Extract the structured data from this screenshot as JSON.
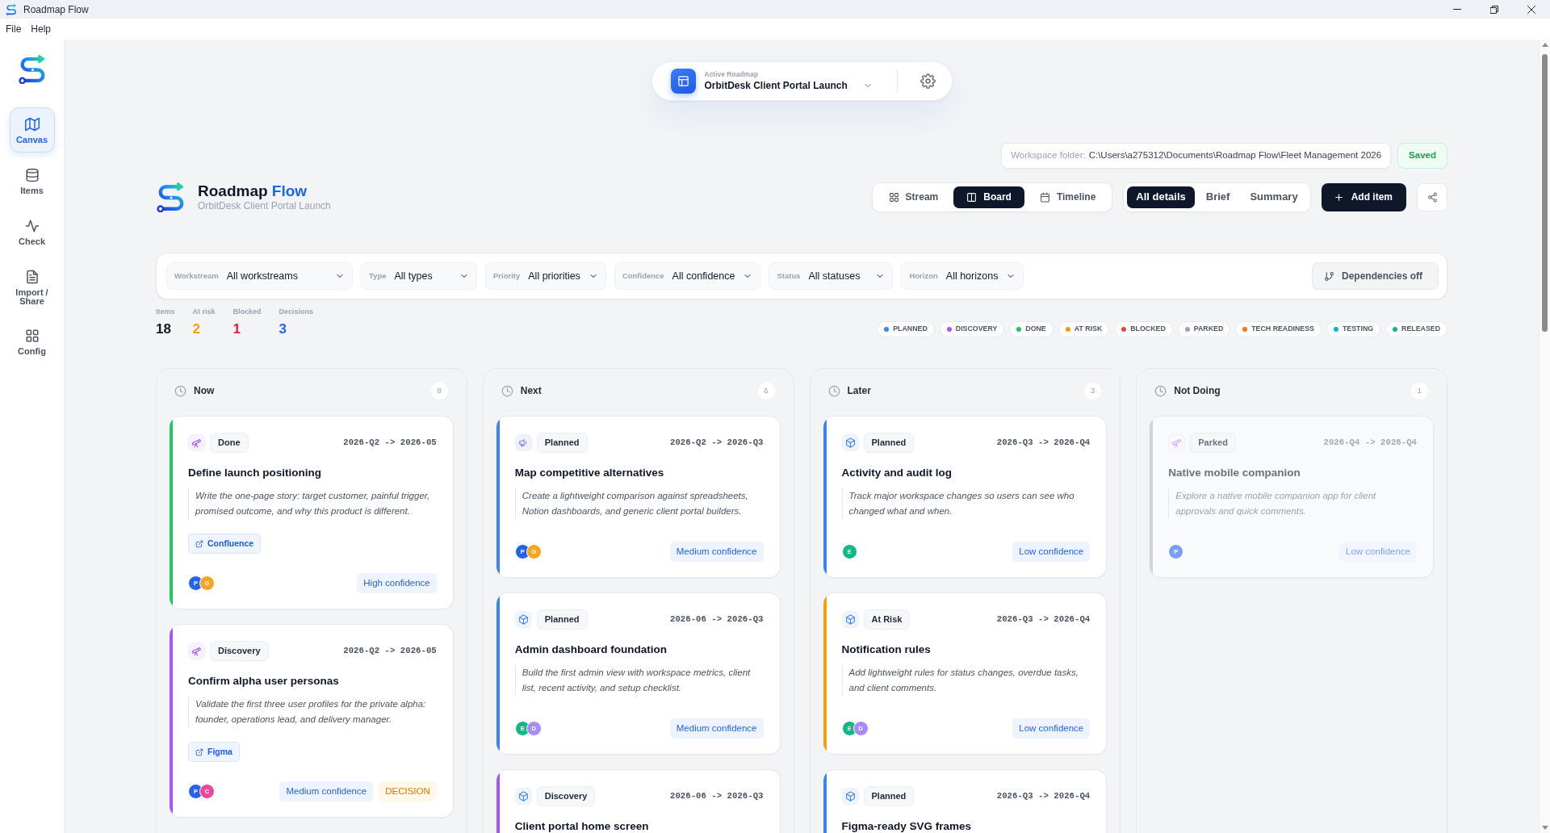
{
  "window": {
    "title": "Roadmap Flow"
  },
  "menu": [
    {
      "label": "File"
    },
    {
      "label": "Help"
    }
  ],
  "sidebar": {
    "items": [
      {
        "label": "Canvas",
        "kind": "map",
        "selected": true
      },
      {
        "label": "Items",
        "kind": "database",
        "selected": false
      },
      {
        "label": "Check",
        "kind": "pulse",
        "selected": false
      },
      {
        "label": "Import / Share",
        "kind": "document",
        "selected": false
      },
      {
        "label": "Config",
        "kind": "grid",
        "selected": false
      }
    ]
  },
  "active_roadmap": {
    "label": "Active Roadmap",
    "name": "OrbitDesk Client Portal Launch"
  },
  "workspace": {
    "label": "Workspace folder:",
    "path": "C:\\Users\\a275312\\Documents\\Roadmap Flow\\Fleet Management 2026",
    "save_state": "Saved"
  },
  "brand": {
    "name": "Roadmap",
    "accent": "Flow",
    "subtitle": "OrbitDesk Client Portal Launch"
  },
  "view_modes": [
    {
      "label": "Stream",
      "kind": "stream",
      "selected": false
    },
    {
      "label": "Board",
      "kind": "board",
      "selected": true
    },
    {
      "label": "Timeline",
      "kind": "timeline",
      "selected": false
    }
  ],
  "detail_modes": [
    {
      "label": "All details",
      "selected": true
    },
    {
      "label": "Brief",
      "selected": false
    },
    {
      "label": "Summary",
      "selected": false
    }
  ],
  "add_button": {
    "label": "Add item"
  },
  "filters": [
    {
      "label": "Workstream",
      "value": "All workstreams"
    },
    {
      "label": "Type",
      "value": "All types"
    },
    {
      "label": "Priority",
      "value": "All priorities"
    },
    {
      "label": "Confidence",
      "value": "All confidence"
    },
    {
      "label": "Status",
      "value": "All statuses"
    },
    {
      "label": "Horizon",
      "value": "All horizons"
    }
  ],
  "dependencies_button": {
    "label": "Dependencies off"
  },
  "stats": [
    {
      "label": "Items",
      "value": "18",
      "color": "#111827"
    },
    {
      "label": "At risk",
      "value": "2",
      "color": "#f59e0b"
    },
    {
      "label": "Blocked",
      "value": "1",
      "color": "#f0173d"
    },
    {
      "label": "Decisions",
      "value": "3",
      "color": "#2563eb"
    }
  ],
  "legend": [
    {
      "label": "PLANNED",
      "color": "#3b82f6"
    },
    {
      "label": "DISCOVERY",
      "color": "#a855f7"
    },
    {
      "label": "DONE",
      "color": "#22c55e"
    },
    {
      "label": "AT RISK",
      "color": "#f59e0b"
    },
    {
      "label": "BLOCKED",
      "color": "#ef4444"
    },
    {
      "label": "PARKED",
      "color": "#9ca3af"
    },
    {
      "label": "TECH READINESS",
      "color": "#f97316"
    },
    {
      "label": "TESTING",
      "color": "#06b6d4"
    },
    {
      "label": "RELEASED",
      "color": "#10b981"
    }
  ],
  "columns": [
    {
      "title": "Now",
      "count": "8",
      "cards": [
        {
          "kind": "research",
          "status": "Done",
          "color": "#22c55e",
          "dates": "2026-Q2 -> 2026-05",
          "title": "Define launch positioning",
          "description": "Write the one-page story: target customer, painful trigger, promised outcome, and why this product is different.",
          "link": "Confluence",
          "avatars": [
            {
              "letter": "P",
              "color": "#2563eb"
            },
            {
              "letter": "G",
              "color": "#f5a524"
            }
          ],
          "confidence": "High confidence",
          "faded": false
        },
        {
          "kind": "research",
          "status": "Discovery",
          "color": "#a855f7",
          "dates": "2026-Q2 -> 2026-05",
          "title": "Confirm alpha user personas",
          "description": "Validate the first three user profiles for the private alpha: founder, operations lead, and delivery manager.",
          "link": "Figma",
          "avatars": [
            {
              "letter": "P",
              "color": "#2563eb"
            },
            {
              "letter": "C",
              "color": "#ec4899"
            }
          ],
          "confidence": "Medium confidence",
          "decision": "DECISION",
          "faded": false
        }
      ]
    },
    {
      "title": "Next",
      "count": "6",
      "cards": [
        {
          "kind": "marketing",
          "status": "Planned",
          "color": "#3b82f6",
          "dates": "2026-Q2 -> 2026-Q3",
          "title": "Map competitive alternatives",
          "description": "Create a lightweight comparison against spreadsheets, Notion dashboards, and generic client portal builders.",
          "avatars": [
            {
              "letter": "P",
              "color": "#2563eb"
            },
            {
              "letter": "G",
              "color": "#f5a524"
            }
          ],
          "confidence": "Medium confidence",
          "faded": false
        },
        {
          "kind": "feature",
          "status": "Planned",
          "color": "#3b82f6",
          "dates": "2026-06 -> 2026-Q3",
          "title": "Admin dashboard foundation",
          "description": "Build the first admin view with workspace metrics, client list, recent activity, and setup checklist.",
          "avatars": [
            {
              "letter": "E",
              "color": "#10b981"
            },
            {
              "letter": "D",
              "color": "#a78bfa"
            }
          ],
          "confidence": "Medium confidence",
          "faded": false
        },
        {
          "kind": "feature",
          "status": "Discovery",
          "color": "#a855f7",
          "dates": "2026-06 -> 2026-Q3",
          "title": "Client portal home screen",
          "faded": false
        }
      ]
    },
    {
      "title": "Later",
      "count": "3",
      "cards": [
        {
          "kind": "feature",
          "status": "Planned",
          "color": "#3b82f6",
          "dates": "2026-Q3 -> 2026-Q4",
          "title": "Activity and audit log",
          "description": "Track major workspace changes so users can see who changed what and when.",
          "avatars": [
            {
              "letter": "E",
              "color": "#10b981"
            }
          ],
          "confidence": "Low confidence",
          "faded": false
        },
        {
          "kind": "feature",
          "status": "At Risk",
          "color": "#f59e0b",
          "dates": "2026-Q3 -> 2026-Q4",
          "title": "Notification rules",
          "description": "Add lightweight rules for status changes, overdue tasks, and client comments.",
          "avatars": [
            {
              "letter": "E",
              "color": "#10b981"
            },
            {
              "letter": "D",
              "color": "#a78bfa"
            }
          ],
          "confidence": "Low confidence",
          "faded": false
        },
        {
          "kind": "feature",
          "status": "Planned",
          "color": "#3b82f6",
          "dates": "2026-Q3 -> 2026-Q4",
          "title": "Figma-ready SVG frames",
          "faded": false
        }
      ]
    },
    {
      "title": "Not Doing",
      "count": "1",
      "cards": [
        {
          "kind": "research",
          "status": "Parked",
          "color": "#d1d5db",
          "dates": "2026-Q4 -> 2026-Q4",
          "title": "Native mobile companion",
          "description": "Explore a native mobile companion app for client approvals and quick comments.",
          "avatars": [
            {
              "letter": "P",
              "color": "#7c9ef2"
            }
          ],
          "confidence": "Low confidence",
          "faded": true
        }
      ]
    }
  ]
}
